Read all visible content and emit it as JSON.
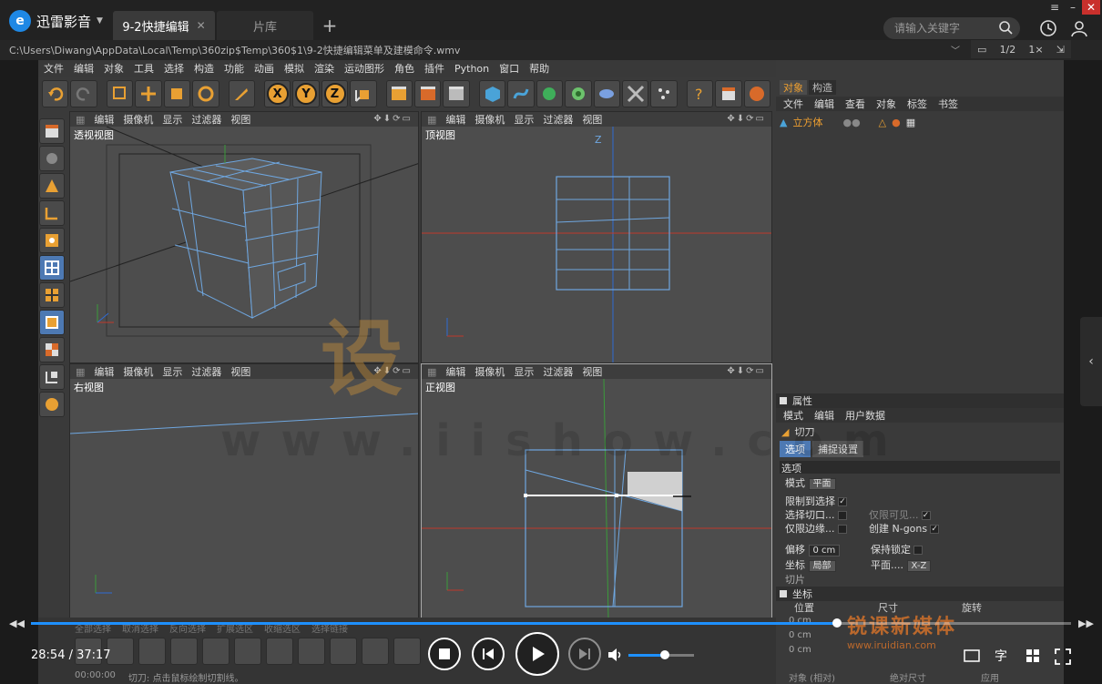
{
  "player": {
    "logo_mark": "e",
    "app_name": "迅雷影音",
    "active_tab": "9-2快捷编辑",
    "inactive_tab": "片库",
    "search_placeholder": "请输入关键字",
    "filepath": "C:\\Users\\Diwang\\AppData\\Local\\Temp\\360zip$Temp\\360$1\\9-2快捷编辑菜单及建模命令.wmv",
    "pip_controls": [
      "1/2",
      "1×"
    ],
    "time": "28:54 / 37:17",
    "progress": 0.775,
    "volume": 0.55,
    "subtitle_btn": "字",
    "accent": "#1e90ff"
  },
  "c4d": {
    "menu": [
      "文件",
      "编辑",
      "对象",
      "工具",
      "选择",
      "构造",
      "功能",
      "动画",
      "模拟",
      "渲染",
      "运动图形",
      "角色",
      "插件",
      "Python",
      "窗口",
      "帮助"
    ],
    "axis_buttons": [
      "X",
      "Y",
      "Z"
    ],
    "viewport_menu": [
      "编辑",
      "摄像机",
      "显示",
      "过滤器",
      "视图"
    ],
    "viewports": {
      "persp": "透视视图",
      "top": "顶视图",
      "right": "右视图",
      "front": "正视图"
    },
    "axis_label_z": "Z",
    "object_manager": {
      "tabs": [
        "对象",
        "构造"
      ],
      "menu": [
        "文件",
        "编辑",
        "查看",
        "对象",
        "标签",
        "书签"
      ],
      "object_name": "立方体"
    },
    "attributes": {
      "title": "属性",
      "menu": [
        "模式",
        "编辑",
        "用户数据"
      ],
      "tool_name": "切刀",
      "subtabs": [
        "选项",
        "捕捉设置"
      ],
      "section": "选项",
      "mode_label": "模式",
      "mode_value": "平面",
      "restrict_label": "限制到选择",
      "select_cuts_label": "选择切口...",
      "visible_only_label": "仅限可见...",
      "boundary_only_label": "仅限边缘...",
      "create_ngons_label": "创建 N-gons",
      "offset_label": "偏移",
      "offset_value": "0 cm",
      "keep_lock_label": "保持锁定",
      "coord_label": "坐标",
      "coord_value": "局部",
      "plane_label": "平面....",
      "plane_value": "X-Z",
      "cut_label": "切片"
    },
    "coords": {
      "title": "坐标",
      "cols": [
        "位置",
        "尺寸",
        "旋转"
      ],
      "values": [
        "0 cm",
        "0 cm",
        "0 cm"
      ],
      "mode_value": "对象 (相对)",
      "size_value": "绝对尺寸",
      "apply": "应用"
    },
    "status": {
      "select_row": [
        "全部选择",
        "取消选择",
        "反向选择",
        "扩展选区",
        "收缩选区",
        "选择链接"
      ],
      "timecode": "00:00:00",
      "hint": "切刀: 点击鼠标绘制切割线。"
    }
  },
  "watermark": {
    "chars": "设",
    "url": "www.iishow.com",
    "brand_cn": "锐课新媒体",
    "brand_url": "www.iruidian.com"
  }
}
